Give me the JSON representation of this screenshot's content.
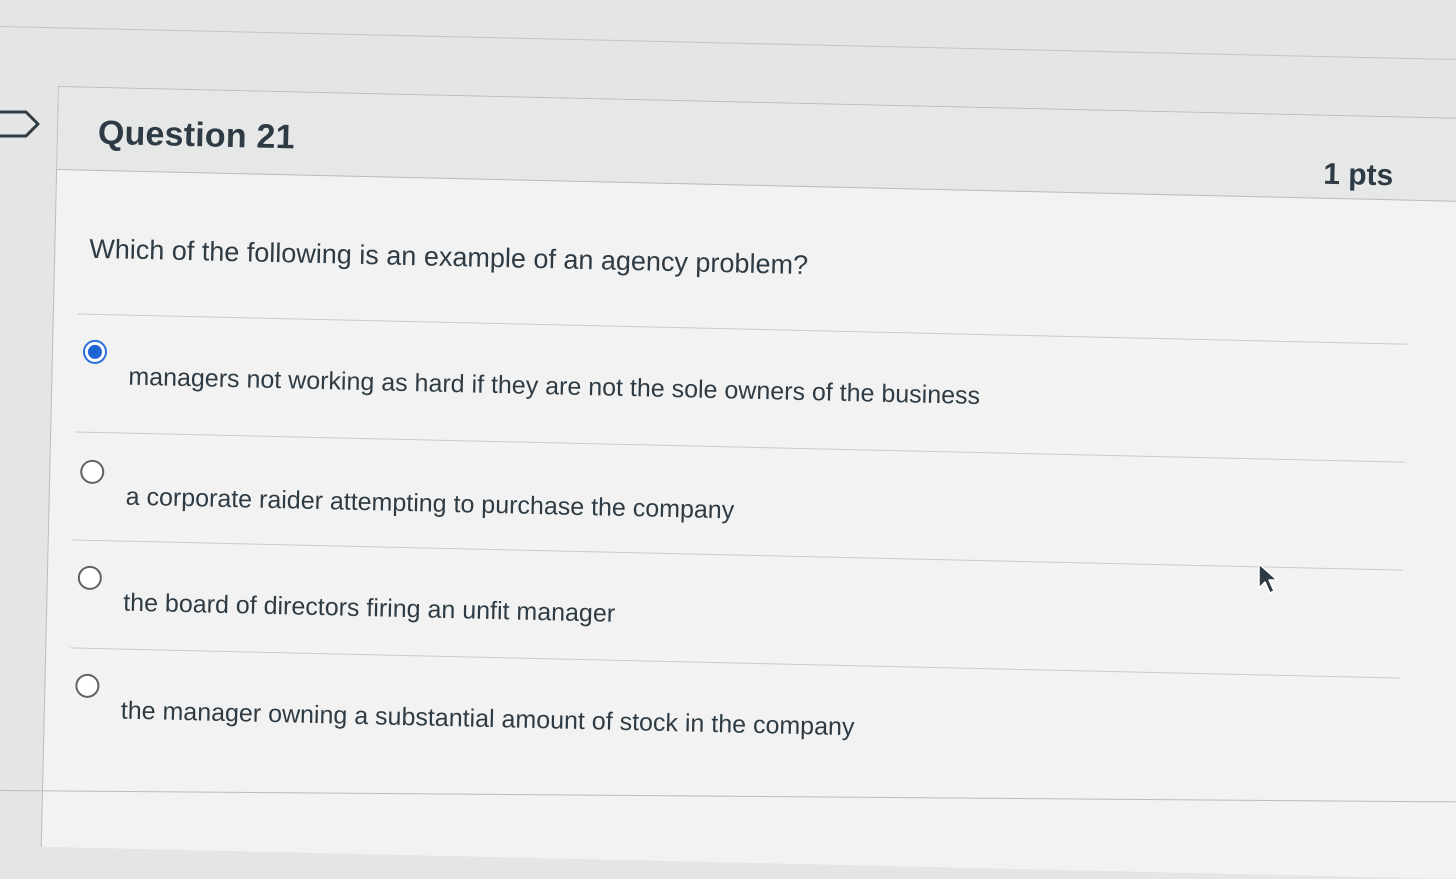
{
  "question": {
    "title": "Question 21",
    "points": "1 pts",
    "text": "Which of the following is an example of an agency problem?"
  },
  "answers": [
    {
      "label": "managers not working as hard if they are not the sole owners of the business",
      "selected": true
    },
    {
      "label": "a corporate raider attempting to purchase the company",
      "selected": false
    },
    {
      "label": "the board of directors firing an unfit manager",
      "selected": false
    },
    {
      "label": "the manager owning a substantial amount of stock in the company",
      "selected": false
    }
  ],
  "colors": {
    "selected_radio": "#1d63d1",
    "text": "#2f3b44",
    "background": "#f1f2f1"
  },
  "icons": {
    "flag": "flag-outline-icon",
    "cursor": "mouse-pointer-icon"
  }
}
